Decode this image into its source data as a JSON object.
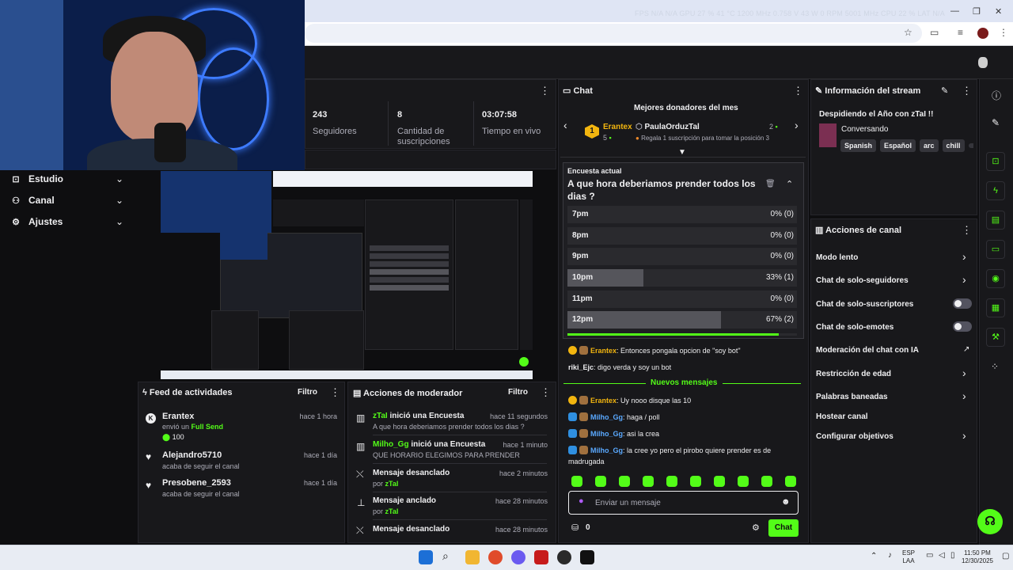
{
  "browser": {
    "perf_overlay": "FPS  N/A  N/A      GPU  27 %  41 °C  1200 MHz  0.758 V  43 W  0 RPM  5001 MHz      CPU  22 %       LAT  N/A",
    "window_controls": [
      "—",
      "❐",
      "✕"
    ]
  },
  "nav": {
    "items": [
      {
        "label": "Estudio",
        "icon": "studio-icon"
      },
      {
        "label": "Canal",
        "icon": "channel-icon"
      },
      {
        "label": "Ajustes",
        "icon": "settings-icon"
      }
    ]
  },
  "stats": [
    {
      "value": "243",
      "label": "Seguidores"
    },
    {
      "value": "8",
      "label": "Cantidad de suscripciones"
    },
    {
      "value": "03:07:58",
      "label": "Tiempo en vivo"
    }
  ],
  "feed": {
    "title": "Feed de actividades",
    "filter": "Filtro",
    "items": [
      {
        "name": "Erantex",
        "sub1": "envió un",
        "sub2": "Full Send",
        "amount": "100",
        "time": "hace 1 hora"
      },
      {
        "name": "Alejandro5710",
        "sub1": "acaba de seguir el canal",
        "time": "hace 1 día"
      },
      {
        "name": "Presobene_2593",
        "sub1": "acaba de seguir el canal",
        "time": "hace 1 día"
      }
    ]
  },
  "modactions": {
    "title": "Acciones de moderador",
    "filter": "Filtro",
    "items": [
      {
        "user": "zTaI",
        "action": "inició una Encuesta",
        "detail": "A que hora deberiamos prender todos los dias ?",
        "time": "hace 11 segundos"
      },
      {
        "user": "Milho_Gg",
        "action": "inició una Encuesta",
        "detail": "QUE HORARIO ELEGIMOS PARA PRENDER",
        "time": "hace 1 minuto"
      },
      {
        "action": "Mensaje desanclado",
        "by": "por",
        "user": "zTaI",
        "time": "hace 2 minutos"
      },
      {
        "action": "Mensaje anclado",
        "by": "por",
        "user": "zTaI",
        "time": "hace 28 minutos"
      },
      {
        "action": "Mensaje desanclado",
        "time": "hace 28 minutos"
      }
    ]
  },
  "chat": {
    "title": "Chat",
    "donors_title": "Mejores donadores del mes",
    "donor1": {
      "rank": "1",
      "name": "Erantex",
      "amount": "5"
    },
    "donor2": {
      "name": "PaulaOrduzTal",
      "amount": "2",
      "note": "Regala 1 suscripción para tomar la posición 3"
    },
    "poll": {
      "header": "Encuesta actual",
      "question": "A que hora deberiamos prender todos los dias ?",
      "options": [
        {
          "label": "7pm",
          "result": "0% (0)",
          "fraction": 0
        },
        {
          "label": "8pm",
          "result": "0% (0)",
          "fraction": 0
        },
        {
          "label": "9pm",
          "result": "0% (0)",
          "fraction": 0
        },
        {
          "label": "10pm",
          "result": "33% (1)",
          "fraction": 0.33
        },
        {
          "label": "11pm",
          "result": "0% (0)",
          "fraction": 0
        },
        {
          "label": "12pm",
          "result": "67% (2)",
          "fraction": 0.67
        }
      ],
      "time_remaining_fraction": 0.92
    },
    "messages_before": [
      {
        "user": "Erantex",
        "text": ": Entonces pongala opcion de \"soy bot\""
      },
      {
        "user": "riki_Ejc",
        "text": ": digo verda y soy un bot"
      }
    ],
    "new_messages_label": "Nuevos mensajes",
    "messages_after": [
      {
        "user": "Erantex",
        "text": ": Uy nooo disque las 10"
      },
      {
        "user": "Milho_Gg",
        "text": ": haga / poll"
      },
      {
        "user": "Milho_Gg",
        "text": ": asi la crea"
      },
      {
        "user": "Milho_Gg",
        "text": ": la cree yo pero el pirobo quiere prender es de madrugada"
      }
    ],
    "input_placeholder": "Enviar un mensaje",
    "points": "0",
    "send_label": "Chat"
  },
  "stream_info": {
    "title": "Información del stream",
    "stream_title": "Despidiendo el Año con zTaI !!",
    "category": "Conversando",
    "tags": [
      "Spanish",
      "Español",
      "arc",
      "chill"
    ]
  },
  "channel_actions": {
    "title": "Acciones de canal",
    "items": [
      {
        "label": "Modo lento",
        "control": "chevron"
      },
      {
        "label": "Chat de solo-seguidores",
        "control": "chevron"
      },
      {
        "label": "Chat de solo-suscriptores",
        "control": "toggle"
      },
      {
        "label": "Chat de solo-emotes",
        "control": "toggle"
      },
      {
        "label": "Moderación del chat con IA",
        "control": "external"
      },
      {
        "label": "Restricción de edad",
        "control": "chevron"
      },
      {
        "label": "Palabras baneadas",
        "control": "chevron"
      },
      {
        "label": "Hostear canal",
        "control": "none"
      },
      {
        "label": "Configurar objetivos",
        "control": "chevron"
      }
    ]
  },
  "taskbar": {
    "lang": "ESP",
    "lang2": "LAA",
    "time": "11:50 PM",
    "date": "12/30/2025"
  },
  "colors": {
    "accent": "#53fc18",
    "bg": "#0e0e10",
    "panel": "#18181b"
  }
}
